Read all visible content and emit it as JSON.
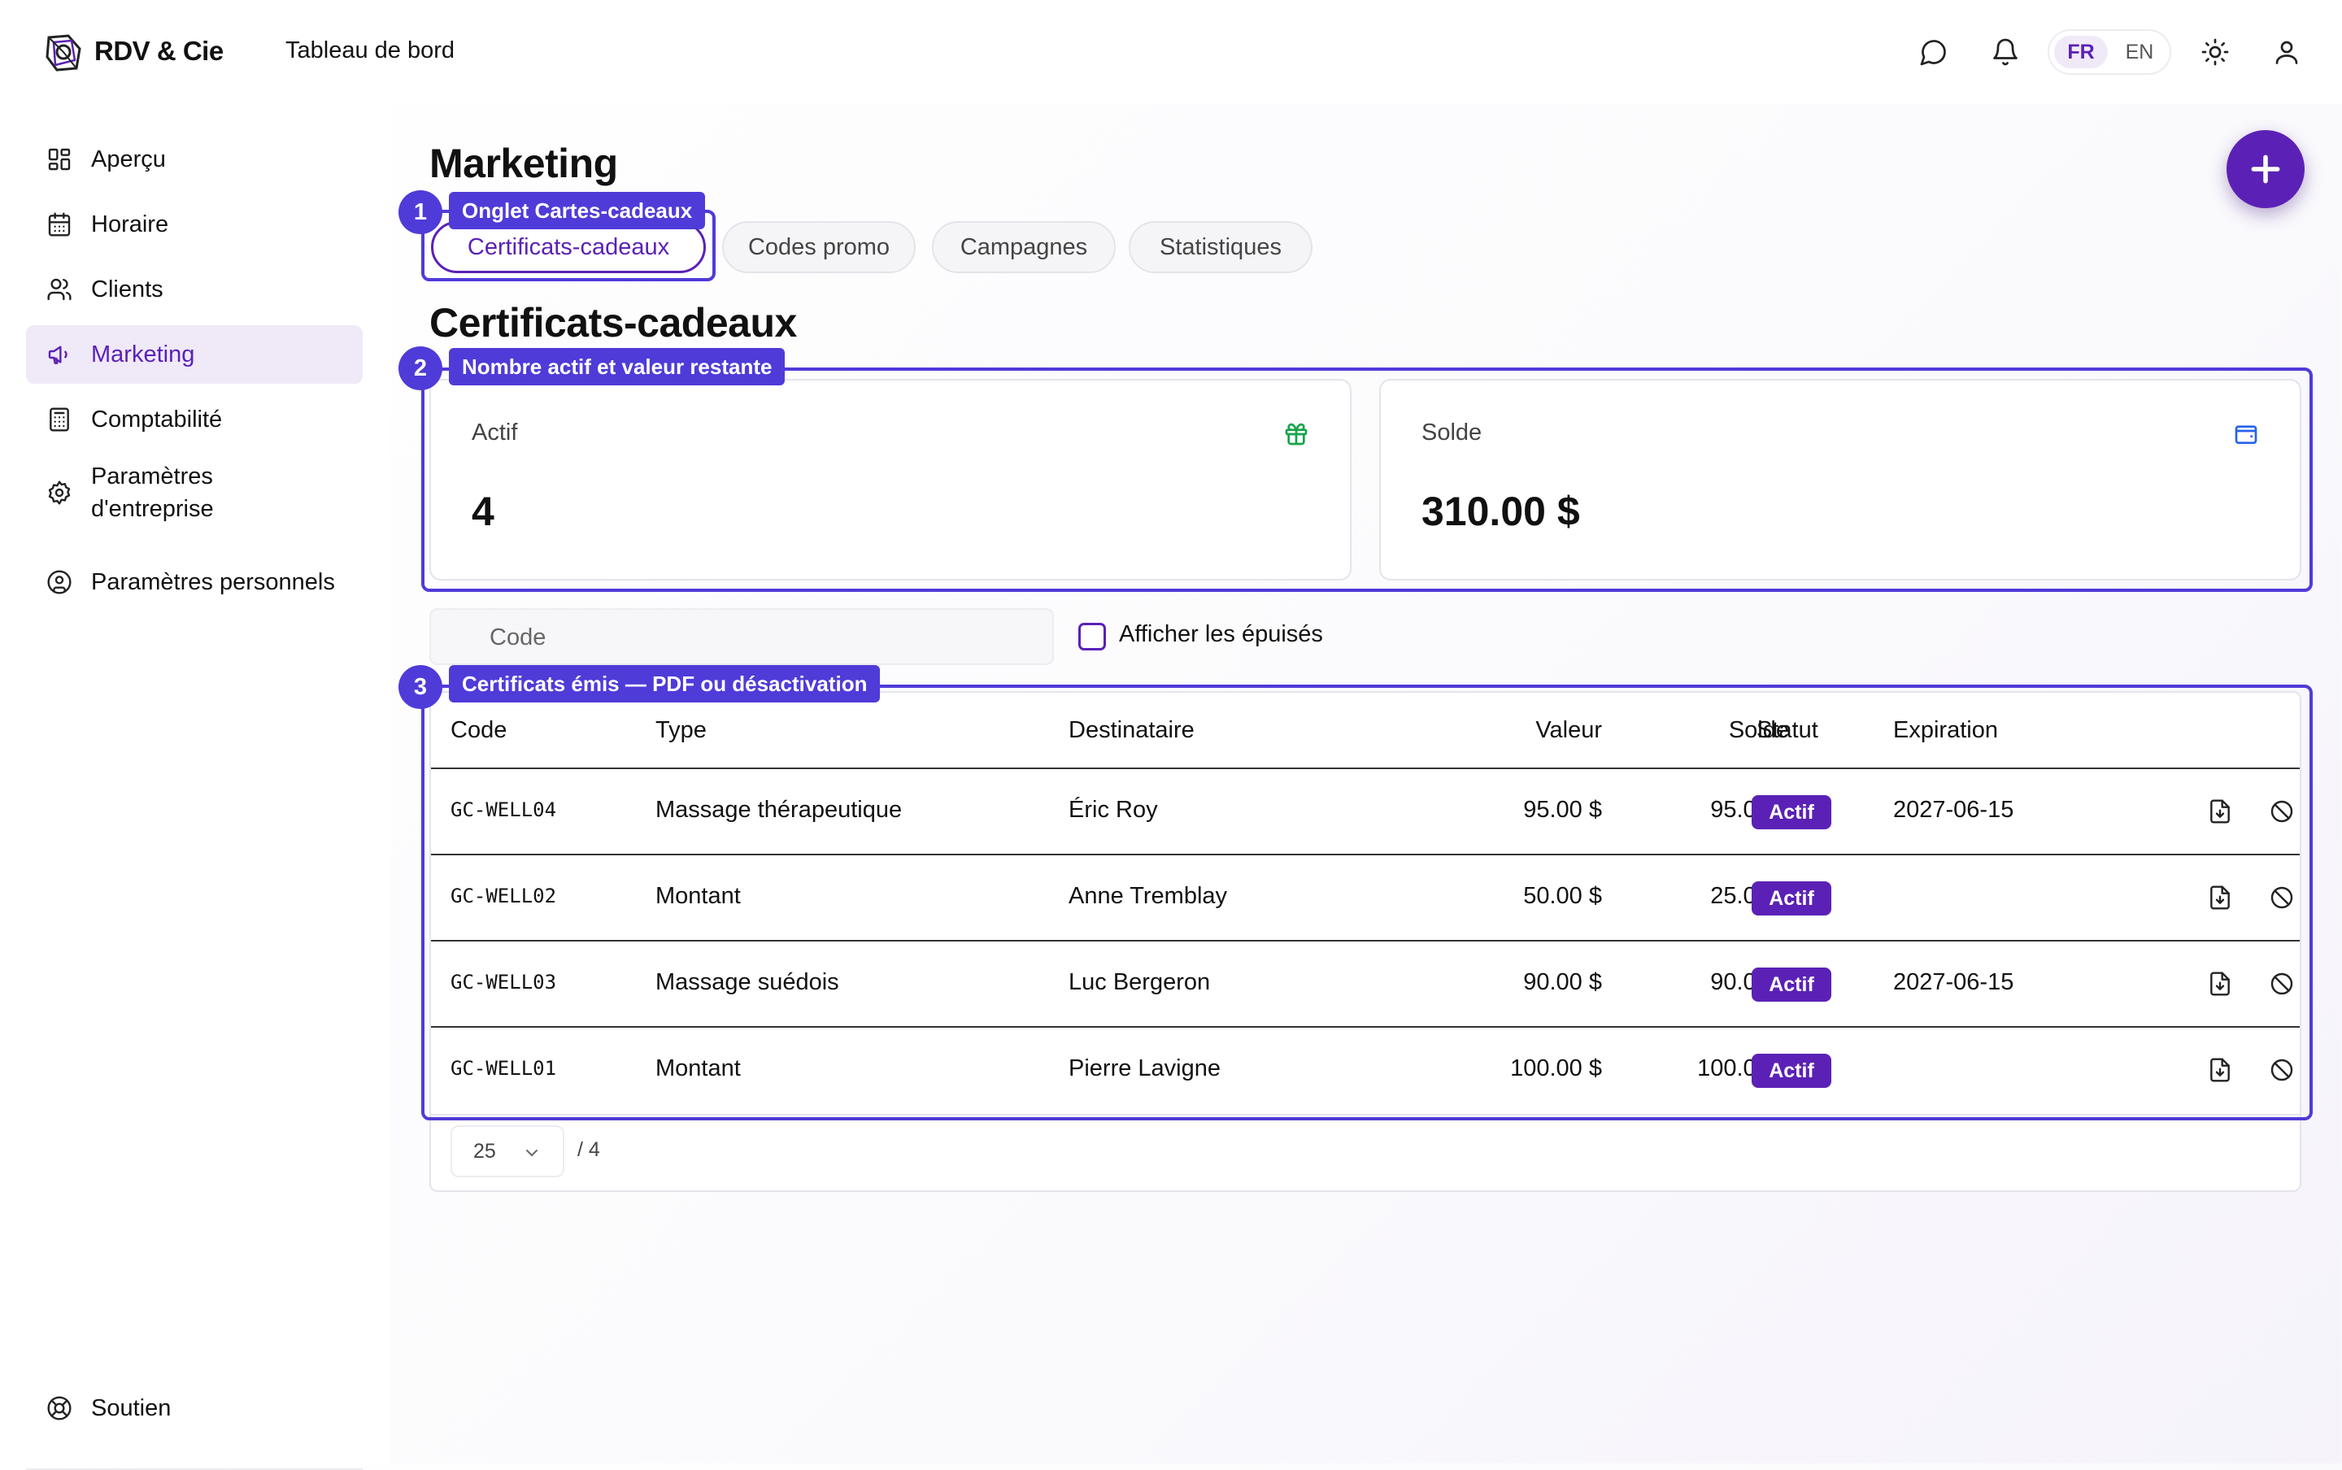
{
  "app": {
    "brand": "RDV & Cie",
    "nav_title": "Tableau de bord"
  },
  "topbar": {
    "icons": [
      "chat-icon",
      "bell-icon",
      "sun-icon",
      "user-icon"
    ],
    "lang": {
      "fr": "FR",
      "en": "EN",
      "selected": "FR"
    }
  },
  "sidebar": {
    "items": [
      {
        "label": "Aperçu",
        "icon": "dashboard-icon"
      },
      {
        "label": "Horaire",
        "icon": "calendar-icon"
      },
      {
        "label": "Clients",
        "icon": "users-icon"
      },
      {
        "label": "Marketing",
        "icon": "megaphone-icon",
        "active": true
      },
      {
        "label": "Comptabilité",
        "icon": "calculator-icon"
      },
      {
        "label": "Paramètres\nd'entreprise",
        "icon": "gear-icon"
      },
      {
        "label": "Paramètres personnels",
        "icon": "user-circle-icon"
      }
    ],
    "support": {
      "label": "Soutien",
      "icon": "lifebuoy-icon"
    }
  },
  "page": {
    "title": "Marketing",
    "tabs": [
      {
        "label": "Certificats-cadeaux",
        "active": true
      },
      {
        "label": "Codes promo"
      },
      {
        "label": "Campagnes"
      },
      {
        "label": "Statistiques"
      }
    ],
    "section_title": "Certificats-cadeaux"
  },
  "stats": {
    "active": {
      "label": "Actif",
      "value": "4",
      "icon": "gift-icon"
    },
    "balance": {
      "label": "Solde",
      "value": "310.00 $",
      "icon": "wallet-icon"
    }
  },
  "filters": {
    "search_placeholder": "Code",
    "show_exhausted_label": "Afficher les épuisés",
    "show_exhausted_checked": false
  },
  "table": {
    "headers": {
      "code": "Code",
      "type": "Type",
      "recipient": "Destinataire",
      "value": "Valeur",
      "balance": "Solde",
      "status": "Statut",
      "expiration": "Expiration"
    },
    "rows": [
      {
        "code": "GC-WELL04",
        "type": "Massage thérapeutique",
        "recipient": "Éric Roy",
        "value": "95.00 $",
        "balance": "95.00 $",
        "status": "Actif",
        "expiration": "2027-06-15"
      },
      {
        "code": "GC-WELL02",
        "type": "Montant",
        "recipient": "Anne Tremblay",
        "value": "50.00 $",
        "balance": "25.00 $",
        "status": "Actif",
        "expiration": ""
      },
      {
        "code": "GC-WELL03",
        "type": "Massage suédois",
        "recipient": "Luc Bergeron",
        "value": "90.00 $",
        "balance": "90.00 $",
        "status": "Actif",
        "expiration": "2027-06-15"
      },
      {
        "code": "GC-WELL01",
        "type": "Montant",
        "recipient": "Pierre Lavigne",
        "value": "100.00 $",
        "balance": "100.00 $",
        "status": "Actif",
        "expiration": ""
      }
    ],
    "row_actions": [
      "pdf-download-icon",
      "deactivate-icon"
    ]
  },
  "pagination": {
    "page_size": "25",
    "total": "/ 4"
  },
  "annotations": [
    {
      "number": "1",
      "label": "Onglet Cartes-cadeaux"
    },
    {
      "number": "2",
      "label": "Nombre actif et valeur restante"
    },
    {
      "number": "3",
      "label": "Certificats émis — PDF ou désactivation"
    }
  ],
  "colors": {
    "accent": "#5b21b6",
    "annotation": "#4f3bd8",
    "gift_icon": "#16a34a",
    "wallet_icon": "#2563eb"
  }
}
